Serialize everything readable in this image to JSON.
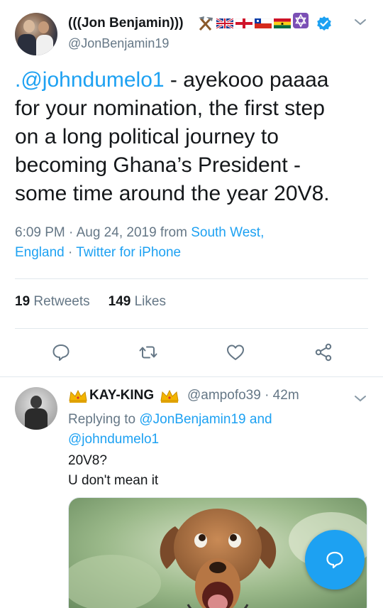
{
  "colors": {
    "accent": "#1da1f2",
    "text": "#14171a",
    "secondary": "#657786",
    "border": "#e1e8ed"
  },
  "main_tweet": {
    "author_name": "(((Jon Benjamin)))",
    "author_handle": "@JonBenjamin19",
    "name_emojis": [
      "hammer-and-pick",
      "uk-flag",
      "england-flag",
      "chile-flag",
      "ghana-flag",
      "star-of-david"
    ],
    "verified": true,
    "text_lines": [
      {
        "mention": ".@johndumelo1",
        "rest": " - ayekooo paaaa"
      },
      {
        "text": "for your nomination, the first step"
      },
      {
        "text": "on a long political journey to"
      },
      {
        "text": "becoming Ghana’s President -"
      },
      {
        "text": "some time around the year 20V8."
      }
    ],
    "time": "6:09 PM · Aug 24, 2019 from ",
    "location_line1": "South West,",
    "location_line2": "England",
    "separator": " · ",
    "source": "Twitter for iPhone",
    "retweets_count": "19",
    "retweets_label": "Retweets",
    "likes_count": "149",
    "likes_label": "Likes",
    "actions": [
      "reply-icon",
      "retweet-icon",
      "like-icon",
      "share-icon"
    ]
  },
  "reply": {
    "author_name": "KAY-KING",
    "author_handle": "@ampofo39 · 42m",
    "replying_prefix": "Replying to ",
    "replying_to_1": "@JonBenjamin19 and",
    "replying_to_2": "@johndumelo1",
    "text_lines": [
      "20V8?",
      "U don't mean it"
    ],
    "media": "dog-image"
  },
  "compose_button": "compose-reply-icon"
}
